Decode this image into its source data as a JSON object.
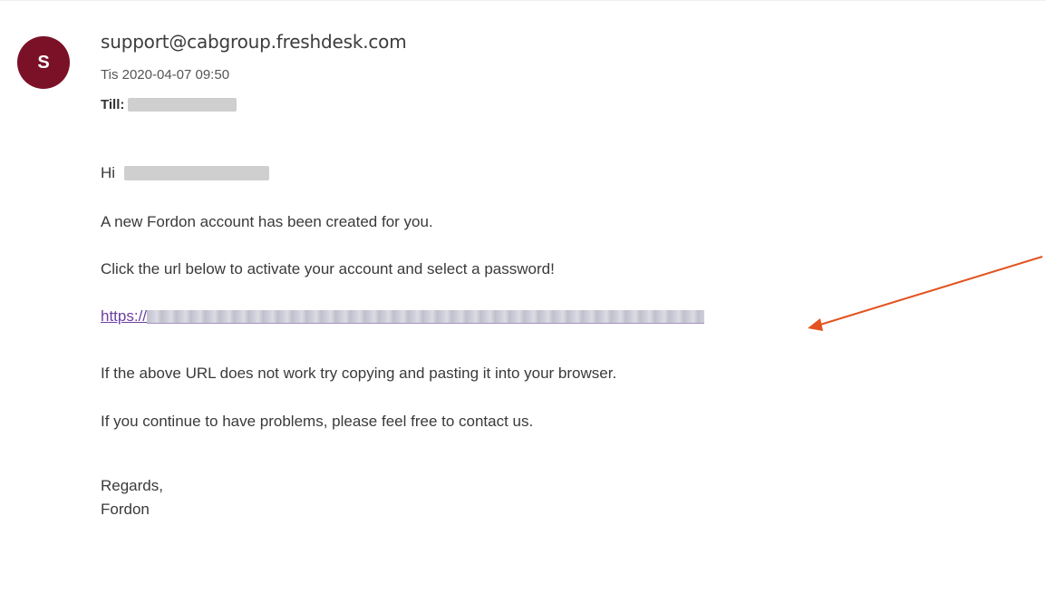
{
  "email": {
    "avatar_letter": "S",
    "avatar_color": "#7b1127",
    "sender": "support@cabgroup.freshdesk.com",
    "date": "Tis 2020-04-07 09:50",
    "to_label": "Till:",
    "greeting": "Hi",
    "body_lines": [
      "A new Fordon account has been created for you.",
      "Click the url below to activate your account and select a password!"
    ],
    "link_prefix": "https://",
    "after_link_lines": [
      "If the above URL does not work try copying and pasting it into your browser.",
      "If you continue to have problems, please feel free to contact us."
    ],
    "signoff": "Regards,",
    "signature": "Fordon"
  },
  "annotation": {
    "arrow_color": "#e2531f"
  },
  "colors": {
    "link": "#6b3fa0"
  }
}
